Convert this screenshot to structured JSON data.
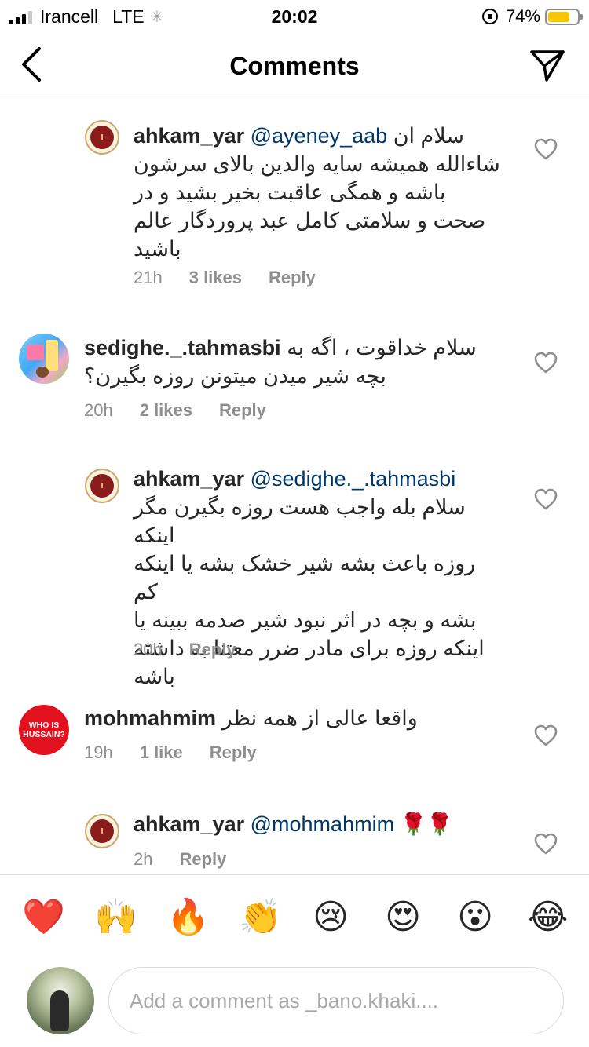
{
  "status_bar": {
    "carrier": "Irancell",
    "network": "LTE",
    "time": "20:02",
    "battery": "74%",
    "battery_level": 0.74,
    "battery_color": "#f7c600"
  },
  "header": {
    "title": "Comments",
    "back_icon": "chevron-left-icon",
    "send_icon": "paper-plane-icon"
  },
  "comments": [
    {
      "username": "ahkam_yar",
      "mention": "@ayeney_aab",
      "text_first": "سلام ان",
      "text_lines": [
        "شاءالله همیشه سایه والدین بالای سرشون",
        "باشه و همگی عاقبت بخیر بشید و در",
        "صحت و سلامتی کامل عبد پروردگار عالم",
        "باشید"
      ],
      "time": "21h",
      "likes": "3 likes",
      "reply": "Reply",
      "is_reply": true
    },
    {
      "username": "sedighe._.tahmasbi",
      "text_first": "سلام خداقوت ، اگه به",
      "text_lines": [
        "بچه شیر میدن میتونن روزه بگیرن؟"
      ],
      "time": "20h",
      "likes": "2 likes",
      "reply": "Reply",
      "is_reply": false
    },
    {
      "username": "ahkam_yar",
      "mention": "@sedighe._.tahmasbi",
      "text_lines": [
        "سلام بله واجب هست روزه بگیرن مگر اینکه",
        "روزه باعث بشه شیر خشک بشه یا اینکه کم",
        "بشه و بچه در اثر نبود شیر صدمه ببینه یا",
        "اینکه روزه برای مادر ضرر معتنا به داشته",
        "باشه"
      ],
      "time": "20h",
      "reply": "Reply",
      "is_reply": true
    },
    {
      "username": "mohmahmim",
      "avatar_text": "WHO IS HUSSAIN?",
      "text_first": "واقعا عالی از همه نظر",
      "time": "19h",
      "likes": "1 like",
      "reply": "Reply",
      "is_reply": false
    },
    {
      "username": "ahkam_yar",
      "mention": "@mohmahmim",
      "emoji_text": "🌹🌹",
      "time": "2h",
      "reply": "Reply",
      "is_reply": true
    }
  ],
  "emoji_bar": [
    "❤️",
    "🙌",
    "🔥",
    "👏",
    "😢",
    "😍",
    "😮",
    "😂"
  ],
  "composer": {
    "placeholder": "Add a comment as _bano.khaki...."
  }
}
